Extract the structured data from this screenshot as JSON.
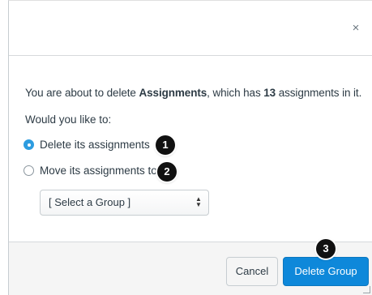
{
  "dialog": {
    "close_glyph": "×",
    "message": {
      "prefix": "You are about to delete ",
      "group_name": "Assignments",
      "middle": ", which has ",
      "count": "13",
      "suffix": " assignments in it."
    },
    "prompt": "Would you like to:",
    "options": [
      {
        "label": "Delete its assignments",
        "checked": true
      },
      {
        "label": "Move its assignments to",
        "checked": false
      }
    ],
    "select": {
      "value": "[ Select a Group ]",
      "arrow_up": "▲",
      "arrow_down": "▼"
    },
    "buttons": {
      "cancel": "Cancel",
      "delete": "Delete Group"
    }
  },
  "callouts": [
    "1",
    "2",
    "3"
  ],
  "colors": {
    "primary": "#0e88da",
    "radio_checked": "#2d9ce0",
    "footer_bg": "#f5f5f5"
  },
  "icons": {
    "close": "close-icon",
    "select": "select-arrows-icon",
    "resize": "resize-grip-icon"
  }
}
